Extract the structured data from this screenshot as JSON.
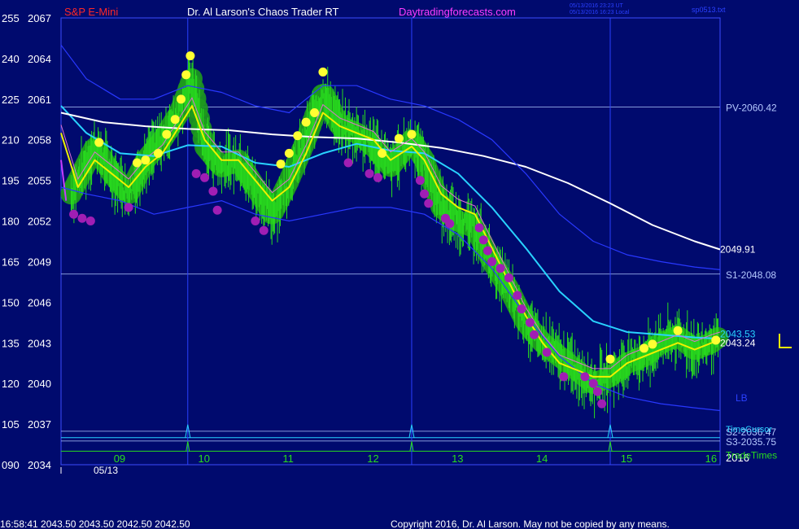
{
  "header": {
    "symbol": "S&P E-Mini",
    "title": "Dr. Al Larson's Chaos Trader RT",
    "site": "Daytradingforecasts.com",
    "stamp_utc": "05/13/2016 23:23 UT",
    "stamp_local": "05/13/2016 16:23 Local",
    "file": "sp0513.txt"
  },
  "colors": {
    "background": "#000a6e",
    "plot_border": "#3c4cff",
    "price_bars": "#28dc1e",
    "fast_ma": "#f0f000",
    "medium_ma": "#28d2ff",
    "slow_ma": "#ffffff",
    "bands": "#2838ff",
    "high_dots": "#ffff32",
    "low_dots": "#a01eb4",
    "level_lines": "#b4c8ff",
    "trade_times": "#28dc1e",
    "time_cursor": "#28d2ff",
    "red_label": "#ff2828",
    "magenta_label": "#ff3cff"
  },
  "chart_data": {
    "type": "line",
    "title": "S&P E-Mini",
    "xlabel": "",
    "ylabel": "",
    "grid": false,
    "legend": "none",
    "xlim": [
      8.3,
      16.1
    ],
    "ylim": [
      2034,
      2067
    ],
    "x_ticks": [
      "09",
      "10",
      "11",
      "12",
      "13",
      "14",
      "15",
      "16"
    ],
    "date_label": "05/13",
    "year_label": "2016",
    "y_left_ticks": [
      "255",
      "240",
      "225",
      "210",
      "195",
      "180",
      "165",
      "150",
      "135",
      "120",
      "105",
      "090"
    ],
    "y_price_ticks": [
      "2067",
      "2064",
      "2061",
      "2058",
      "2055",
      "2052",
      "2049",
      "2046",
      "2043",
      "2040",
      "2037",
      "2034"
    ],
    "series": [
      {
        "role": "price",
        "x": [
          8.3,
          8.5,
          8.7,
          8.9,
          9.1,
          9.3,
          9.5,
          9.7,
          9.85,
          10.0,
          10.2,
          10.4,
          10.6,
          10.8,
          11.0,
          11.2,
          11.4,
          11.6,
          11.8,
          12.0,
          12.2,
          12.45,
          12.6,
          12.8,
          13.0,
          13.2,
          13.4,
          13.6,
          13.8,
          14.0,
          14.2,
          14.4,
          14.6,
          14.8,
          15.0,
          15.2,
          15.4,
          15.6,
          15.8,
          16.0,
          16.1
        ],
        "values": [
          2052.5,
          2055.0,
          2057.5,
          2055.5,
          2054.0,
          2056.5,
          2058.0,
          2060.0,
          2062.5,
          2057.5,
          2056.0,
          2056.5,
          2054.5,
          2052.5,
          2055.0,
          2058.0,
          2061.5,
          2059.0,
          2058.5,
          2057.5,
          2056.0,
          2058.0,
          2056.5,
          2053.0,
          2052.0,
          2051.5,
          2049.0,
          2047.0,
          2044.5,
          2043.0,
          2042.0,
          2041.0,
          2040.0,
          2040.5,
          2041.5,
          2042.0,
          2043.0,
          2043.5,
          2042.5,
          2043.0,
          2043.5
        ]
      },
      {
        "role": "fast-ma",
        "x": [
          8.3,
          8.5,
          8.7,
          8.9,
          9.1,
          9.3,
          9.5,
          9.7,
          9.85,
          10.0,
          10.2,
          10.4,
          10.6,
          10.8,
          11.0,
          11.2,
          11.4,
          11.6,
          11.8,
          12.0,
          12.2,
          12.45,
          12.6,
          12.8,
          13.0,
          13.2,
          13.4,
          13.6,
          13.8,
          14.0,
          14.2,
          14.4,
          14.6,
          14.8,
          15.0,
          15.2,
          15.4,
          15.6,
          15.8,
          16.0,
          16.1
        ],
        "values": [
          2058.5,
          2054.5,
          2056.5,
          2055.5,
          2054.5,
          2056.0,
          2057.0,
          2059.0,
          2060.5,
          2058.0,
          2056.5,
          2056.5,
          2055.0,
          2053.5,
          2054.5,
          2057.0,
          2060.0,
          2059.0,
          2058.5,
          2058.0,
          2056.5,
          2057.5,
          2056.5,
          2054.0,
          2053.0,
          2052.5,
          2050.0,
          2047.5,
          2045.0,
          2043.0,
          2041.5,
          2041.0,
          2040.5,
          2040.5,
          2041.5,
          2042.0,
          2042.5,
          2043.0,
          2042.5,
          2043.0,
          2043.2
        ]
      },
      {
        "role": "medium-ma",
        "x": [
          8.3,
          8.6,
          9.0,
          9.4,
          9.8,
          10.2,
          10.6,
          11.0,
          11.4,
          11.8,
          12.2,
          12.6,
          13.0,
          13.4,
          13.8,
          14.2,
          14.6,
          15.0,
          15.4,
          15.8,
          16.1
        ],
        "values": [
          2060.5,
          2058.5,
          2057.0,
          2056.8,
          2057.6,
          2057.5,
          2056.3,
          2056.0,
          2057.0,
          2057.7,
          2057.2,
          2057.0,
          2055.5,
          2053.0,
          2050.0,
          2046.8,
          2044.6,
          2043.8,
          2043.6,
          2043.4,
          2043.3
        ]
      },
      {
        "role": "slow-ma",
        "x": [
          8.3,
          8.8,
          9.3,
          9.8,
          10.3,
          10.8,
          11.3,
          11.8,
          12.3,
          12.8,
          13.3,
          13.8,
          14.3,
          14.8,
          15.3,
          15.8,
          16.1
        ],
        "values": [
          2060.0,
          2059.3,
          2059.0,
          2058.8,
          2058.7,
          2058.4,
          2058.2,
          2058.1,
          2057.8,
          2057.4,
          2056.8,
          2056.0,
          2054.8,
          2053.3,
          2051.7,
          2050.5,
          2049.9
        ]
      },
      {
        "role": "upper-band",
        "x": [
          8.3,
          8.6,
          9.0,
          9.4,
          9.8,
          10.2,
          10.6,
          11.0,
          11.4,
          11.8,
          12.2,
          12.6,
          13.0,
          13.4,
          13.8,
          14.2,
          14.6,
          15.0,
          15.4,
          15.8,
          16.1
        ],
        "values": [
          2065.0,
          2062.5,
          2061.0,
          2061.0,
          2062.0,
          2061.5,
          2060.5,
          2060.0,
          2062.0,
          2062.0,
          2061.0,
          2060.5,
          2059.5,
          2058.0,
          2055.5,
          2052.5,
          2050.5,
          2049.5,
          2049.0,
          2048.6,
          2048.4
        ]
      },
      {
        "role": "lower-band",
        "x": [
          8.3,
          8.6,
          9.0,
          9.4,
          9.8,
          10.2,
          10.6,
          11.0,
          11.4,
          11.8,
          12.2,
          12.6,
          13.0,
          13.4,
          13.8,
          14.2,
          14.6,
          15.0,
          15.4,
          15.8,
          16.1
        ],
        "values": [
          2054.5,
          2054.0,
          2053.5,
          2052.5,
          2053.0,
          2053.5,
          2052.5,
          2052.0,
          2052.5,
          2053.0,
          2053.0,
          2052.5,
          2051.0,
          2048.5,
          2045.0,
          2042.0,
          2040.0,
          2039.0,
          2038.5,
          2038.2,
          2038.0
        ]
      }
    ],
    "level_lines": [
      {
        "label": "PV-2060.42",
        "value": 2060.42
      },
      {
        "label": "S1-2048.08",
        "value": 2048.08
      },
      {
        "label": "S2-2036.47",
        "value": 2036.47
      },
      {
        "label": "S3-2035.75",
        "value": 2035.75
      }
    ],
    "value_labels": [
      {
        "label": "2049.91",
        "value": 2049.91
      },
      {
        "label": "2043.53",
        "value": 2043.53
      },
      {
        "label": "2043.24",
        "value": 2043.24
      }
    ],
    "band_label": {
      "text": "LB",
      "value": 2039.0
    },
    "time_markers": [
      9.8,
      12.45,
      14.8
    ],
    "time_labels": {
      "cursor": "TimeCursor",
      "trade_times": "TradeTimes"
    },
    "high_points": [
      {
        "x": 8.75,
        "y": 2057.8
      },
      {
        "x": 9.2,
        "y": 2056.3
      },
      {
        "x": 9.3,
        "y": 2056.5
      },
      {
        "x": 9.45,
        "y": 2057.0
      },
      {
        "x": 9.55,
        "y": 2058.4
      },
      {
        "x": 9.65,
        "y": 2059.5
      },
      {
        "x": 9.72,
        "y": 2061.0
      },
      {
        "x": 9.78,
        "y": 2062.8
      },
      {
        "x": 9.83,
        "y": 2064.2
      },
      {
        "x": 10.9,
        "y": 2056.2
      },
      {
        "x": 11.0,
        "y": 2057.0
      },
      {
        "x": 11.1,
        "y": 2058.3
      },
      {
        "x": 11.2,
        "y": 2059.3
      },
      {
        "x": 11.3,
        "y": 2060.0
      },
      {
        "x": 11.4,
        "y": 2063.0
      },
      {
        "x": 12.1,
        "y": 2057.0
      },
      {
        "x": 12.3,
        "y": 2058.1
      },
      {
        "x": 12.45,
        "y": 2058.4
      },
      {
        "x": 14.8,
        "y": 2041.8
      },
      {
        "x": 15.2,
        "y": 2042.6
      },
      {
        "x": 15.3,
        "y": 2042.9
      },
      {
        "x": 15.6,
        "y": 2043.9
      },
      {
        "x": 16.05,
        "y": 2043.2
      }
    ],
    "low_points": [
      {
        "x": 8.45,
        "y": 2052.5
      },
      {
        "x": 8.55,
        "y": 2052.2
      },
      {
        "x": 8.65,
        "y": 2052.0
      },
      {
        "x": 9.1,
        "y": 2053.0
      },
      {
        "x": 9.9,
        "y": 2055.5
      },
      {
        "x": 10.0,
        "y": 2055.2
      },
      {
        "x": 10.1,
        "y": 2054.2
      },
      {
        "x": 10.15,
        "y": 2052.8
      },
      {
        "x": 10.6,
        "y": 2052.0
      },
      {
        "x": 10.7,
        "y": 2051.3
      },
      {
        "x": 11.7,
        "y": 2056.3
      },
      {
        "x": 11.95,
        "y": 2055.5
      },
      {
        "x": 12.05,
        "y": 2055.2
      },
      {
        "x": 12.55,
        "y": 2055.0
      },
      {
        "x": 12.6,
        "y": 2054.0
      },
      {
        "x": 12.65,
        "y": 2053.3
      },
      {
        "x": 12.85,
        "y": 2052.2
      },
      {
        "x": 12.9,
        "y": 2051.8
      },
      {
        "x": 13.25,
        "y": 2051.5
      },
      {
        "x": 13.3,
        "y": 2050.6
      },
      {
        "x": 13.35,
        "y": 2049.8
      },
      {
        "x": 13.4,
        "y": 2049.0
      },
      {
        "x": 13.5,
        "y": 2048.5
      },
      {
        "x": 13.6,
        "y": 2047.8
      },
      {
        "x": 13.7,
        "y": 2046.5
      },
      {
        "x": 13.75,
        "y": 2045.5
      },
      {
        "x": 13.85,
        "y": 2044.5
      },
      {
        "x": 13.9,
        "y": 2043.6
      },
      {
        "x": 14.05,
        "y": 2042.3
      },
      {
        "x": 14.25,
        "y": 2040.5
      },
      {
        "x": 14.5,
        "y": 2040.5
      },
      {
        "x": 14.6,
        "y": 2040.0
      },
      {
        "x": 14.65,
        "y": 2039.4
      },
      {
        "x": 14.7,
        "y": 2038.5
      }
    ]
  },
  "footer": {
    "quote": "16:58:41  2043.50  2043.50  2042.50  2042.50",
    "copyright": "Copyright 2016, Dr. Al Larson. May not be copied by any means."
  }
}
